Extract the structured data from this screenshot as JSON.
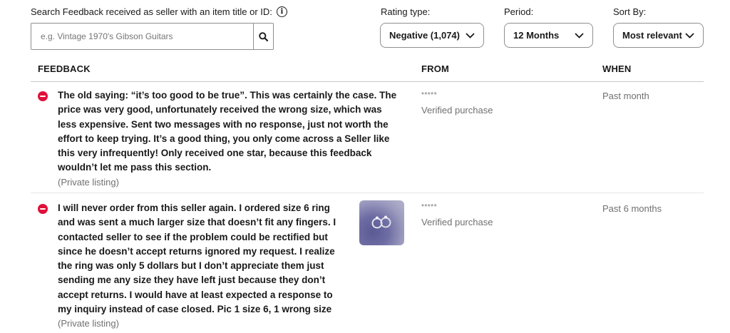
{
  "search": {
    "label": "Search Feedback received as seller with an item title or ID:",
    "placeholder": "e.g. Vintage 1970's Gibson Guitars",
    "value": ""
  },
  "filters": {
    "rating_type": {
      "label": "Rating type:",
      "value": "Negative (1,074)"
    },
    "period": {
      "label": "Period:",
      "value": "12 Months"
    },
    "sort_by": {
      "label": "Sort By:",
      "value": "Most relevant"
    }
  },
  "columns": {
    "feedback": "FEEDBACK",
    "from": "FROM",
    "when": "WHEN"
  },
  "entries": [
    {
      "lines": [
        "The old saying: “it’s too good to be true”. This was certainly the case. The",
        "price was very good, unfortunately received the wrong size, which was",
        "less expensive. Sent two messages with no response, just not worth the",
        "effort to keep trying. It’s a good thing, you only come across a Seller like",
        "this very infrequently! Only received one star, because this feedback",
        "wouldn’t let me pass this section."
      ],
      "listing": "(Private listing)",
      "from_user": "*****",
      "from_note": "Verified purchase",
      "when": "Past month"
    },
    {
      "lines": [
        "I will never order from this seller again. I ordered size 6 ring",
        "and was sent a much larger size that doesn’t fit any fingers. I",
        "contacted seller to see if the problem could be rectified but",
        "since he doesn’t accept returns ignored my request. I realize",
        "the ring was only 5 dollars but I don’t appreciate them just",
        "sending me any size they have left just because they don’t",
        "accept returns. I would have at least expected a response to",
        "my inquiry instead of case closed. Pic 1 size 6, 1 wrong size"
      ],
      "listing": "(Private listing)",
      "from_user": "*****",
      "from_note": "Verified purchase",
      "when": "Past 6 months"
    }
  ],
  "colors": {
    "negative_icon": "#e0103a",
    "muted_text": "#707070",
    "border": "#8f8f8f"
  }
}
